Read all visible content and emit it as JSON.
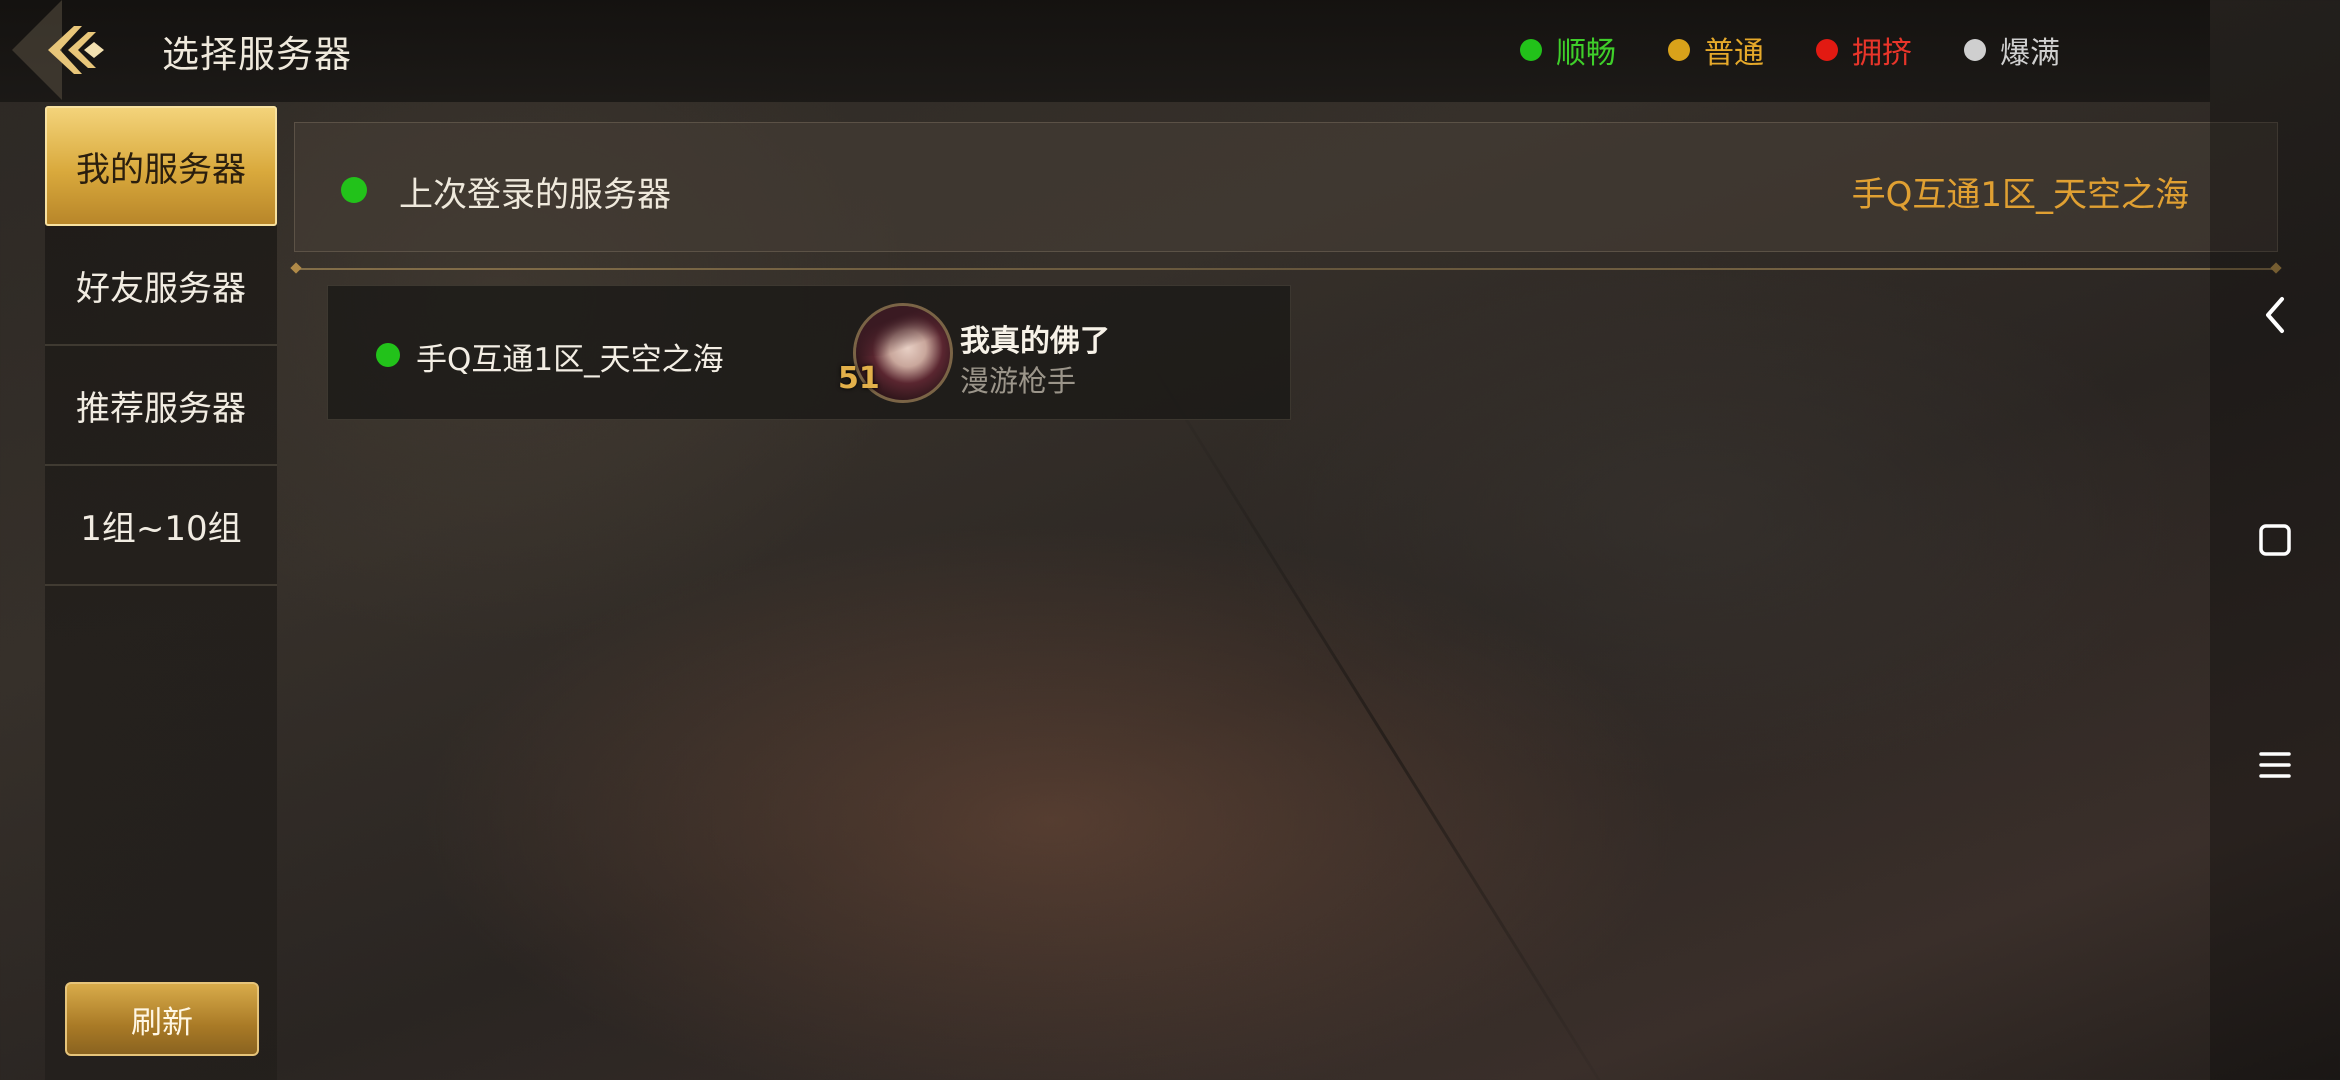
{
  "header": {
    "title": "选择服务器"
  },
  "legend": [
    {
      "label": "顺畅",
      "color": "#22c21a",
      "text_color": "#3fcf2a"
    },
    {
      "label": "普通",
      "color": "#d9a21a",
      "text_color": "#e6a92a"
    },
    {
      "label": "拥挤",
      "color": "#e21a12",
      "text_color": "#e8352a"
    },
    {
      "label": "爆满",
      "color": "#cfcfcf",
      "text_color": "#cfcfcf"
    }
  ],
  "sidebar": {
    "items": [
      {
        "label": "我的服务器",
        "active": true
      },
      {
        "label": "好友服务器",
        "active": false
      },
      {
        "label": "推荐服务器",
        "active": false
      },
      {
        "label": "1组~10组",
        "active": false
      }
    ],
    "refresh_label": "刷新"
  },
  "last_login": {
    "label": "上次登录的服务器",
    "server_name": "手Q互通1区_天空之海",
    "status_color": "#22c21a"
  },
  "servers": [
    {
      "name": "手Q互通1区_天空之海",
      "status_color": "#22c21a",
      "character": {
        "name": "我真的佛了",
        "class": "漫游枪手",
        "level": "51"
      }
    }
  ],
  "system_nav": {
    "icons": [
      "back-icon",
      "home-icon",
      "menu-icon"
    ]
  }
}
